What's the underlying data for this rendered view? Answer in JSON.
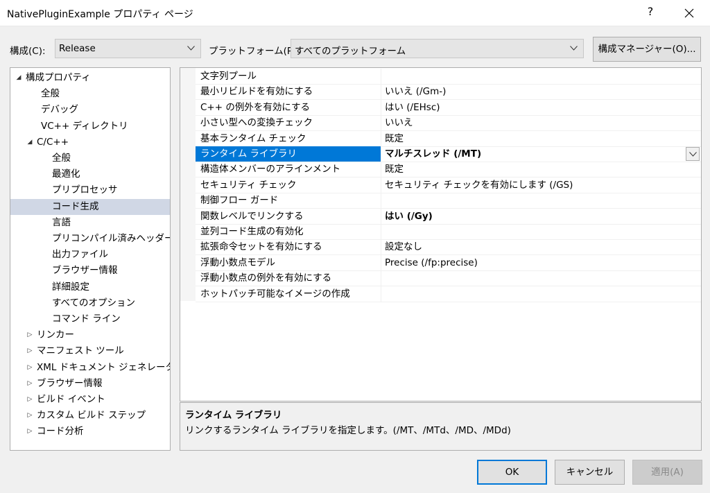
{
  "window": {
    "title": "NativePluginExample プロパティ ページ",
    "help_glyph": "?"
  },
  "config_bar": {
    "config_label": "構成(C):",
    "config_value": "Release",
    "platform_label": "プラットフォーム(P):",
    "platform_value": "すべてのプラットフォーム",
    "manager_button": "構成マネージャー(O)..."
  },
  "tree": {
    "items": [
      {
        "label": "構成プロパティ",
        "arrow": "◢",
        "depth": 0
      },
      {
        "label": "全般",
        "arrow": "",
        "depth": 1
      },
      {
        "label": "デバッグ",
        "arrow": "",
        "depth": 1
      },
      {
        "label": "VC++ ディレクトリ",
        "arrow": "",
        "depth": 1
      },
      {
        "label": "C/C++",
        "arrow": "◢",
        "depth": 1
      },
      {
        "label": "全般",
        "arrow": "",
        "depth": 2
      },
      {
        "label": "最適化",
        "arrow": "",
        "depth": 2
      },
      {
        "label": "プリプロセッサ",
        "arrow": "",
        "depth": 2
      },
      {
        "label": "コード生成",
        "arrow": "",
        "depth": 2,
        "selected": true
      },
      {
        "label": "言語",
        "arrow": "",
        "depth": 2
      },
      {
        "label": "プリコンパイル済みヘッダー",
        "arrow": "",
        "depth": 2
      },
      {
        "label": "出力ファイル",
        "arrow": "",
        "depth": 2
      },
      {
        "label": "ブラウザー情報",
        "arrow": "",
        "depth": 2
      },
      {
        "label": "詳細設定",
        "arrow": "",
        "depth": 2
      },
      {
        "label": "すべてのオプション",
        "arrow": "",
        "depth": 2
      },
      {
        "label": "コマンド ライン",
        "arrow": "",
        "depth": 2
      },
      {
        "label": "リンカー",
        "arrow": "▷",
        "depth": 1
      },
      {
        "label": "マニフェスト ツール",
        "arrow": "▷",
        "depth": 1
      },
      {
        "label": "XML ドキュメント ジェネレーター",
        "arrow": "▷",
        "depth": 1
      },
      {
        "label": "ブラウザー情報",
        "arrow": "▷",
        "depth": 1
      },
      {
        "label": "ビルド イベント",
        "arrow": "▷",
        "depth": 1
      },
      {
        "label": "カスタム ビルド ステップ",
        "arrow": "▷",
        "depth": 1
      },
      {
        "label": "コード分析",
        "arrow": "▷",
        "depth": 1
      }
    ]
  },
  "properties": {
    "rows": [
      {
        "name": "文字列プール",
        "value": ""
      },
      {
        "name": "最小リビルドを有効にする",
        "value": "いいえ (/Gm-)"
      },
      {
        "name": "C++ の例外を有効にする",
        "value": "はい (/EHsc)"
      },
      {
        "name": "小さい型への変換チェック",
        "value": "いいえ"
      },
      {
        "name": "基本ランタイム チェック",
        "value": "既定"
      },
      {
        "name": "ランタイム ライブラリ",
        "value": "マルチスレッド (/MT)",
        "bold": true,
        "selected": true
      },
      {
        "name": "構造体メンバーのアラインメント",
        "value": "既定"
      },
      {
        "name": "セキュリティ チェック",
        "value": "セキュリティ チェックを有効にします (/GS)"
      },
      {
        "name": "制御フロー ガード",
        "value": ""
      },
      {
        "name": "関数レベルでリンクする",
        "value": "はい (/Gy)",
        "bold": true
      },
      {
        "name": "並列コード生成の有効化",
        "value": ""
      },
      {
        "name": "拡張命令セットを有効にする",
        "value": "設定なし"
      },
      {
        "name": "浮動小数点モデル",
        "value": "Precise (/fp:precise)"
      },
      {
        "name": "浮動小数点の例外を有効にする",
        "value": ""
      },
      {
        "name": "ホットパッチ可能なイメージの作成",
        "value": ""
      }
    ]
  },
  "description": {
    "title": "ランタイム ライブラリ",
    "text": "リンクするランタイム ライブラリを指定します。(/MT、/MTd、/MD、/MDd)"
  },
  "buttons": {
    "ok": "OK",
    "cancel": "キャンセル",
    "apply": "適用(A)"
  },
  "icons": {
    "close": "close-icon",
    "combo": "chevron-down-icon"
  },
  "colors": {
    "selection": "#0078d7",
    "tree_selection": "#d0d7e5"
  }
}
